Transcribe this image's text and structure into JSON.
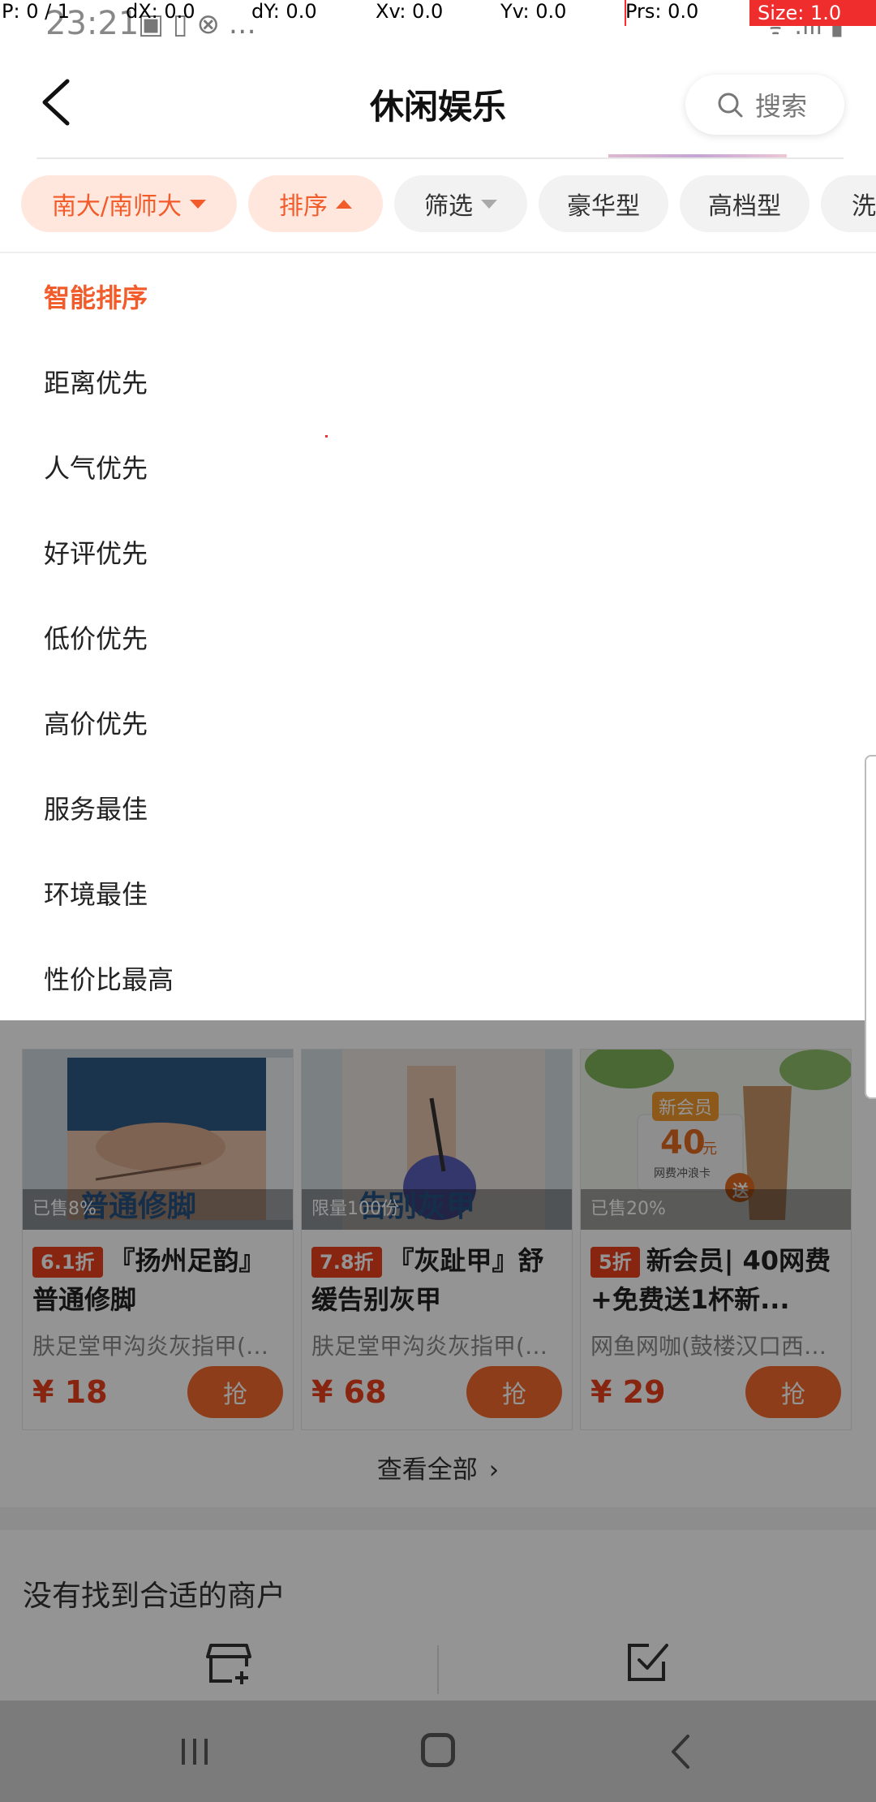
{
  "debug": {
    "p": "P: 0 / 1",
    "dx": "dX: 0.0",
    "dy": "dY: 0.0",
    "xv": "Xv: 0.0",
    "yv": "Yv: 0.0",
    "prs": "Prs: 0.0",
    "size": "Size: 1.0"
  },
  "status": {
    "time": "23:21",
    "icons": "▣ ▯ ⊗ …",
    "right": "ᯤ .ıll ▮"
  },
  "header": {
    "title": "休闲娱乐",
    "search_label": "搜索"
  },
  "chips": [
    {
      "label": "南大/南师大"
    },
    {
      "label": "排序"
    },
    {
      "label": "筛选"
    },
    {
      "label": "豪华型"
    },
    {
      "label": "高档型"
    },
    {
      "label": "洗"
    }
  ],
  "sort_menu": [
    {
      "label": "智能排序",
      "active": true
    },
    {
      "label": "距离优先"
    },
    {
      "label": "人气优先"
    },
    {
      "label": "好评优先"
    },
    {
      "label": "低价优先"
    },
    {
      "label": "高价优先"
    },
    {
      "label": "服务最佳"
    },
    {
      "label": "环境最佳"
    },
    {
      "label": "性价比最高"
    }
  ],
  "deals": [
    {
      "sold": "已售8%",
      "caption": "普通修脚",
      "discount": "6.1折",
      "title": "『扬州足韵』普通修脚",
      "shop": "肤足堂甲沟炎灰指甲(汉...",
      "price": "¥ 18",
      "button": "抢"
    },
    {
      "sold": "限量100份",
      "caption": "告别灰甲",
      "discount": "7.8折",
      "title": "『灰趾甲』舒缓告别灰甲",
      "shop": "肤足堂甲沟炎灰指甲(汉...",
      "price": "¥ 68",
      "button": "抢"
    },
    {
      "sold": "已售20%",
      "caption": "",
      "badge": "新会员",
      "card_value": "40",
      "card_unit": "元",
      "card_sub": "网费冲浪卡",
      "gift": "送",
      "discount": "5折",
      "title": "新会员| 40网费+免费送1杯新...",
      "shop": "网鱼网咖(鼓楼汉口西路店)",
      "price": "¥ 29",
      "button": "抢"
    }
  ],
  "see_all": "查看全部",
  "not_found": "没有找到合适的商户",
  "colors": {
    "accent": "#f25b2a",
    "price": "#e8401c",
    "button": "#f36a2b",
    "chip_active_bg": "#ffe7dd"
  }
}
